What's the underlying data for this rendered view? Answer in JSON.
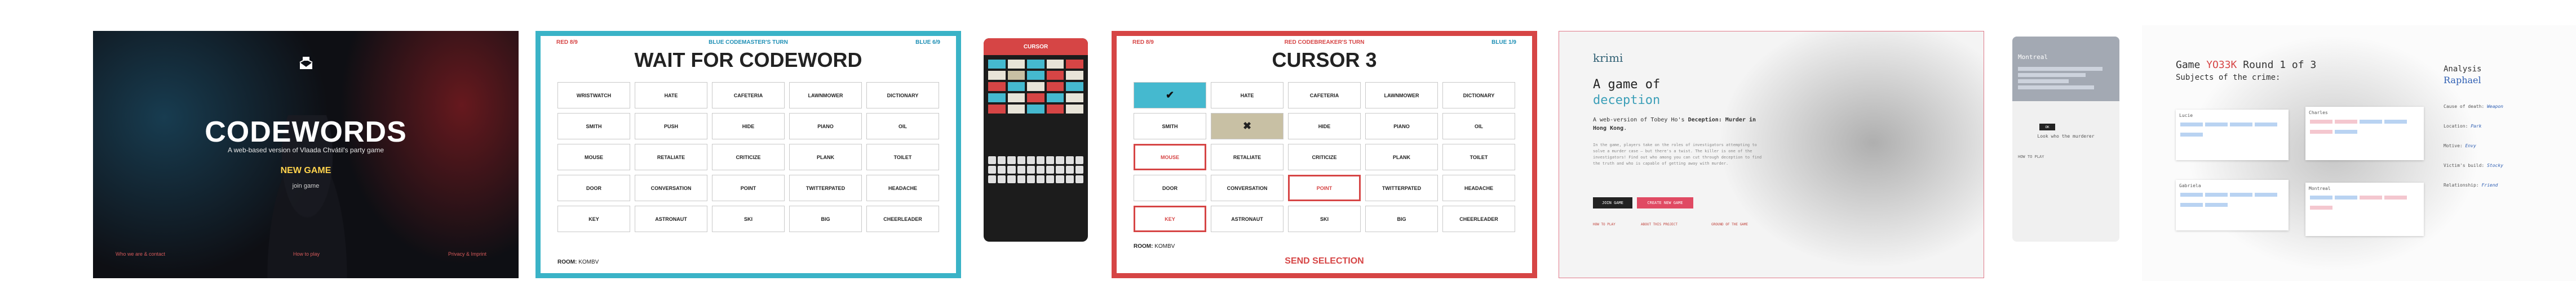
{
  "codewords_home": {
    "title": "CODEWORDS",
    "tagline": "A web-based version of Vlaada Chvátil's party game",
    "new_game": "NEW GAME",
    "join_game": "join game",
    "footer": [
      "Who we are & contact",
      "How to play",
      "Privacy & Imprint"
    ]
  },
  "codewords_wait": {
    "score_left": "RED 8/9",
    "header": "BLUE CODEMASTER'S TURN",
    "score_right": "BLUE 6/9",
    "title": "WAIT FOR CODEWORD",
    "words": [
      "WRISTWATCH",
      "HATE",
      "CAFETERIA",
      "LAWNMOWER",
      "DICTIONARY",
      "SMITH",
      "PUSH",
      "HIDE",
      "PIANO",
      "OIL",
      "MOUSE",
      "RETALIATE",
      "CRITICIZE",
      "PLANK",
      "TOILET",
      "DOOR",
      "CONVERSATION",
      "POINT",
      "TWITTERPATED",
      "HEADACHE",
      "KEY",
      "ASTRONAUT",
      "SKI",
      "BIG",
      "CHEERLEADER"
    ],
    "room_label": "ROOM:",
    "room_code": "KOMBV"
  },
  "codewords_phone": {
    "title": "CURSOR"
  },
  "codewords_cursor": {
    "score_left": "RED 8/9",
    "header": "RED CODEBREAKER'S TURN",
    "score_right": "BLUE 1/9",
    "title": "CURSOR 3",
    "words": [
      "",
      "HATE",
      "CAFETERIA",
      "LAWNMOWER",
      "DICTIONARY",
      "SMITH",
      "",
      "HIDE",
      "PIANO",
      "OIL",
      "MOUSE",
      "RETALIATE",
      "CRITICIZE",
      "PLANK",
      "TOILET",
      "DOOR",
      "CONVERSATION",
      "POINT",
      "TWITTERPATED",
      "HEADACHE",
      "KEY",
      "ASTRONAUT",
      "SKI",
      "BIG",
      "CHEERLEADER"
    ],
    "room_label": "ROOM:",
    "room_code": "KOMBV",
    "send": "SEND SELECTION",
    "check": "✔",
    "cross": "✖"
  },
  "krimi_landing": {
    "brand": "krimi",
    "headline1": "A game of",
    "headline2": "deception",
    "subtitle_pre": "A web-version of Tobey Ho's ",
    "subtitle_bold": "Deception: Murder in Hong Kong",
    "subtitle_post": ".",
    "description": "In the game, players take on the roles of investigators attempting to solve a murder case — but there's a twist. The killer is one of the investigators! Find out who among you can cut through deception to find the truth and who is capable of getting away with murder.",
    "btn_join": "JOIN GAME",
    "btn_create": "CREATE NEW GAME",
    "links": [
      "HOW TO PLAY",
      "ABOUT THIS PROJECT",
      "GROUND OF THE GAME"
    ]
  },
  "krimi_phone": {
    "city": "Montreal",
    "pill": "OK",
    "waiting": "Look who the murderer",
    "link": "HOW TO PLAY"
  },
  "krimi_board": {
    "game_label": "Game",
    "game_code": "YO33K",
    "round": "Round 1 of 3",
    "subjects": "Subjects of the crime:",
    "cards": [
      "Lucie",
      "Charles",
      "Montreal",
      "Gabriela"
    ],
    "analysis_title": "Analysis",
    "analysis_name": "Raphael",
    "analysis_rows": [
      {
        "label": "Cause of death:",
        "value": "Weapon"
      },
      {
        "label": "Location:",
        "value": "Park"
      },
      {
        "label": "Motive:",
        "value": "Envy"
      },
      {
        "label": "Victim's build:",
        "value": "Stocky"
      },
      {
        "label": "Relationship:",
        "value": "Friend"
      }
    ]
  },
  "colors": {
    "cw_blue": "#3ab3c7",
    "cw_red": "#d64545",
    "krimi_pink": "#e04a63",
    "krimi_teal": "#3c9fb8"
  }
}
